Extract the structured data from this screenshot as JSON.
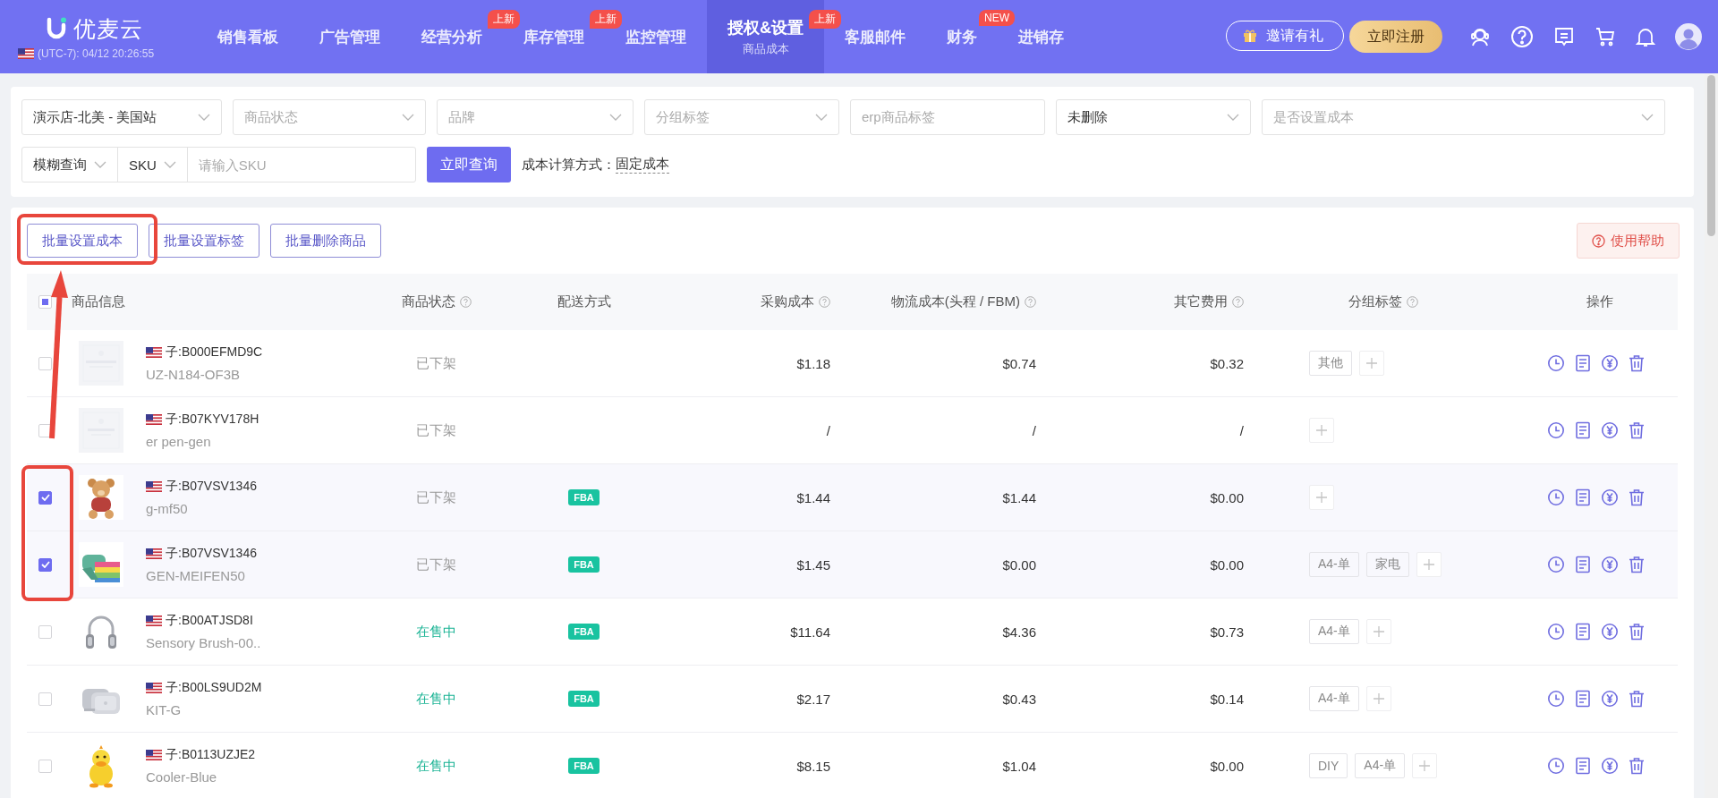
{
  "header": {
    "logo": "优麦云",
    "clock": "(UTC-7): 04/12 20:26:55",
    "nav": [
      {
        "label": "销售看板",
        "selected": false
      },
      {
        "label": "广告管理",
        "selected": false
      },
      {
        "label": "经营分析",
        "selected": false,
        "badge": "上新"
      },
      {
        "label": "库存管理",
        "selected": false,
        "badge": "上新"
      },
      {
        "label": "监控管理",
        "selected": false
      },
      {
        "label": "授权&设置",
        "subtitle": "商品成本",
        "selected": true,
        "badge": "上新"
      },
      {
        "label": "客服邮件",
        "selected": false
      },
      {
        "label": "财务",
        "selected": false,
        "badge": "NEW"
      },
      {
        "label": "进销存",
        "selected": false
      }
    ],
    "invite_button": "邀请有礼",
    "register_button": "立即注册"
  },
  "filters": {
    "selects": [
      {
        "value": "演示店-北美 - 美国站",
        "chevron": true
      },
      {
        "placeholder": "商品状态",
        "chevron": true
      },
      {
        "placeholder": "品牌",
        "chevron": true
      },
      {
        "placeholder": "分组标签",
        "chevron": true
      },
      {
        "placeholder": "erp商品标签",
        "chevron": false
      },
      {
        "value": "未删除",
        "chevron": true
      },
      {
        "placeholder": "是否设置成本",
        "chevron": true
      }
    ],
    "match_mode": "模糊查询",
    "search_field": "SKU",
    "search": {
      "placeholder": "请输入SKU"
    },
    "query_button": "立即查询",
    "cost_method_label": "成本计算方式：",
    "cost_method": "固定成本"
  },
  "actions": [
    "批量设置成本",
    "批量设置标签",
    "批量删除商品"
  ],
  "help_button": "使用帮助",
  "table": {
    "select_all_indeterminate": true,
    "columns": [
      {
        "label": "商品信息",
        "help": false
      },
      {
        "label": "商品状态",
        "help": true
      },
      {
        "label": "配送方式",
        "help": false
      },
      {
        "label": "采购成本",
        "help": true
      },
      {
        "label": "物流成本(头程 / FBM)",
        "help": true
      },
      {
        "label": "其它费用",
        "help": true
      },
      {
        "label": "分组标签",
        "help": true
      },
      {
        "label": "操作",
        "help": false
      }
    ],
    "rows": [
      {
        "checked": false,
        "asin": "子:B000EFMD9C",
        "sku": "UZ-N184-OF3B",
        "status": "已下架",
        "on_sale": false,
        "purchase": "$1.18",
        "logistics": "$0.74",
        "other": "$0.32",
        "tags": [
          "其他"
        ]
      },
      {
        "checked": false,
        "asin": "子:B07KYV178H",
        "sku": "er pen-gen",
        "status": "已下架",
        "on_sale": false,
        "purchase": "/",
        "logistics": "/",
        "other": "/",
        "tags": []
      },
      {
        "checked": true,
        "asin": "子:B07VSV1346",
        "sku": "g-mf50",
        "status": "已下架",
        "on_sale": false,
        "fulfillment": "FBA",
        "purchase": "$1.44",
        "logistics": "$1.44",
        "other": "$0.00",
        "tags": []
      },
      {
        "checked": true,
        "asin": "子:B07VSV1346",
        "sku": "GEN-MEIFEN50",
        "status": "已下架",
        "on_sale": false,
        "fulfillment": "FBA",
        "purchase": "$1.45",
        "logistics": "$0.00",
        "other": "$0.00",
        "tags": [
          "A4-单",
          "家电"
        ]
      },
      {
        "checked": false,
        "asin": "子:B00ATJSD8I",
        "sku": "Sensory Brush-00..",
        "status": "在售中",
        "on_sale": true,
        "fulfillment": "FBA",
        "purchase": "$11.64",
        "logistics": "$4.36",
        "other": "$0.73",
        "tags": [
          "A4-单"
        ]
      },
      {
        "checked": false,
        "asin": "子:B00LS9UD2M",
        "sku": "KIT-G",
        "status": "在售中",
        "on_sale": true,
        "fulfillment": "FBA",
        "purchase": "$2.17",
        "logistics": "$0.43",
        "other": "$0.14",
        "tags": [
          "A4-单"
        ]
      },
      {
        "checked": false,
        "asin": "子:B0113UZJE2",
        "sku": "Cooler-Blue",
        "status": "在售中",
        "on_sale": true,
        "fulfillment": "FBA",
        "purchase": "$8.15",
        "logistics": "$1.04",
        "other": "$0.00",
        "tags": [
          "DIY",
          "A4-单"
        ]
      }
    ]
  }
}
